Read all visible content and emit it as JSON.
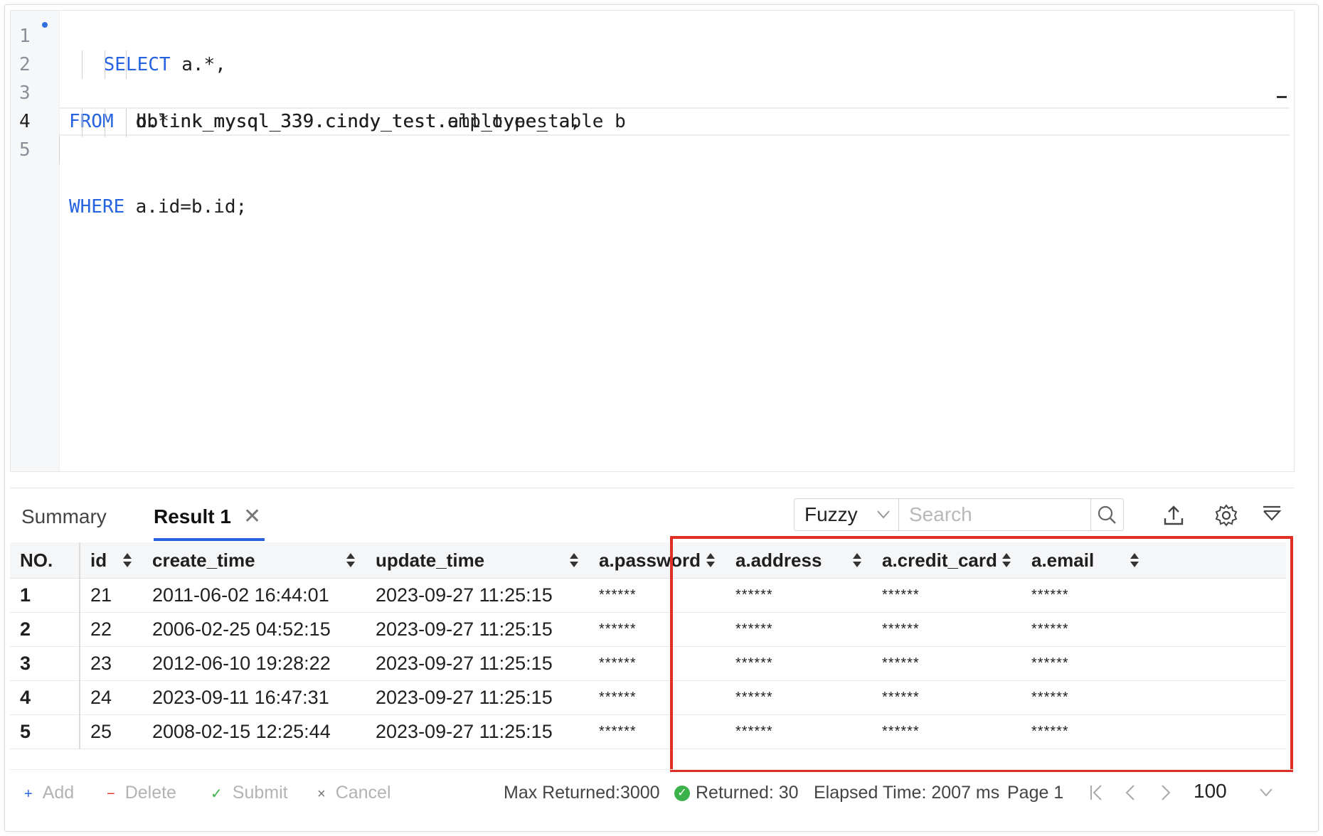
{
  "editor": {
    "line_numbers": [
      "1",
      "2",
      "3",
      "4",
      "5"
    ],
    "lines": [
      {
        "kw": "SELECT",
        "text": " a.*,"
      },
      {
        "kw": "",
        "text": "b.*"
      },
      {
        "kw": "FROM",
        "text": " dblink_mysql_339.cindy_test.employees a,"
      },
      {
        "kw": "",
        "text": "dblink_mysql_339.cindy_test.all_type_table b"
      },
      {
        "kw": "WHERE",
        "text": " a.id=b.id;"
      }
    ]
  },
  "results": {
    "tabs": {
      "summary": "Summary",
      "result": "Result 1"
    },
    "filter": {
      "mode": "Fuzzy",
      "search_placeholder": "Search"
    },
    "columns": [
      "NO.",
      "id",
      "create_time",
      "update_time",
      "a.password",
      "a.address",
      "a.credit_card",
      "a.email"
    ],
    "rows": [
      [
        "1",
        "21",
        "2011-06-02 16:44:01",
        "2023-09-27 11:25:15",
        "******",
        "******",
        "******",
        "******"
      ],
      [
        "2",
        "22",
        "2006-02-25 04:52:15",
        "2023-09-27 11:25:15",
        "******",
        "******",
        "******",
        "******"
      ],
      [
        "3",
        "23",
        "2012-06-10 19:28:22",
        "2023-09-27 11:25:15",
        "******",
        "******",
        "******",
        "******"
      ],
      [
        "4",
        "24",
        "2023-09-11 16:47:31",
        "2023-09-27 11:25:15",
        "******",
        "******",
        "******",
        "******"
      ],
      [
        "5",
        "25",
        "2008-02-15 12:25:44",
        "2023-09-27 11:25:15",
        "******",
        "******",
        "******",
        "******"
      ]
    ]
  },
  "footer": {
    "add": "Add",
    "delete": "Delete",
    "submit": "Submit",
    "cancel": "Cancel",
    "max_returned": "Max Returned:3000",
    "returned": "Returned: 30",
    "elapsed": "Elapsed Time: 2007 ms",
    "page": "Page 1",
    "page_size": "100"
  },
  "colors": {
    "accent": "#2563e0",
    "highlight": "#e03026",
    "success": "#3cb34a"
  }
}
